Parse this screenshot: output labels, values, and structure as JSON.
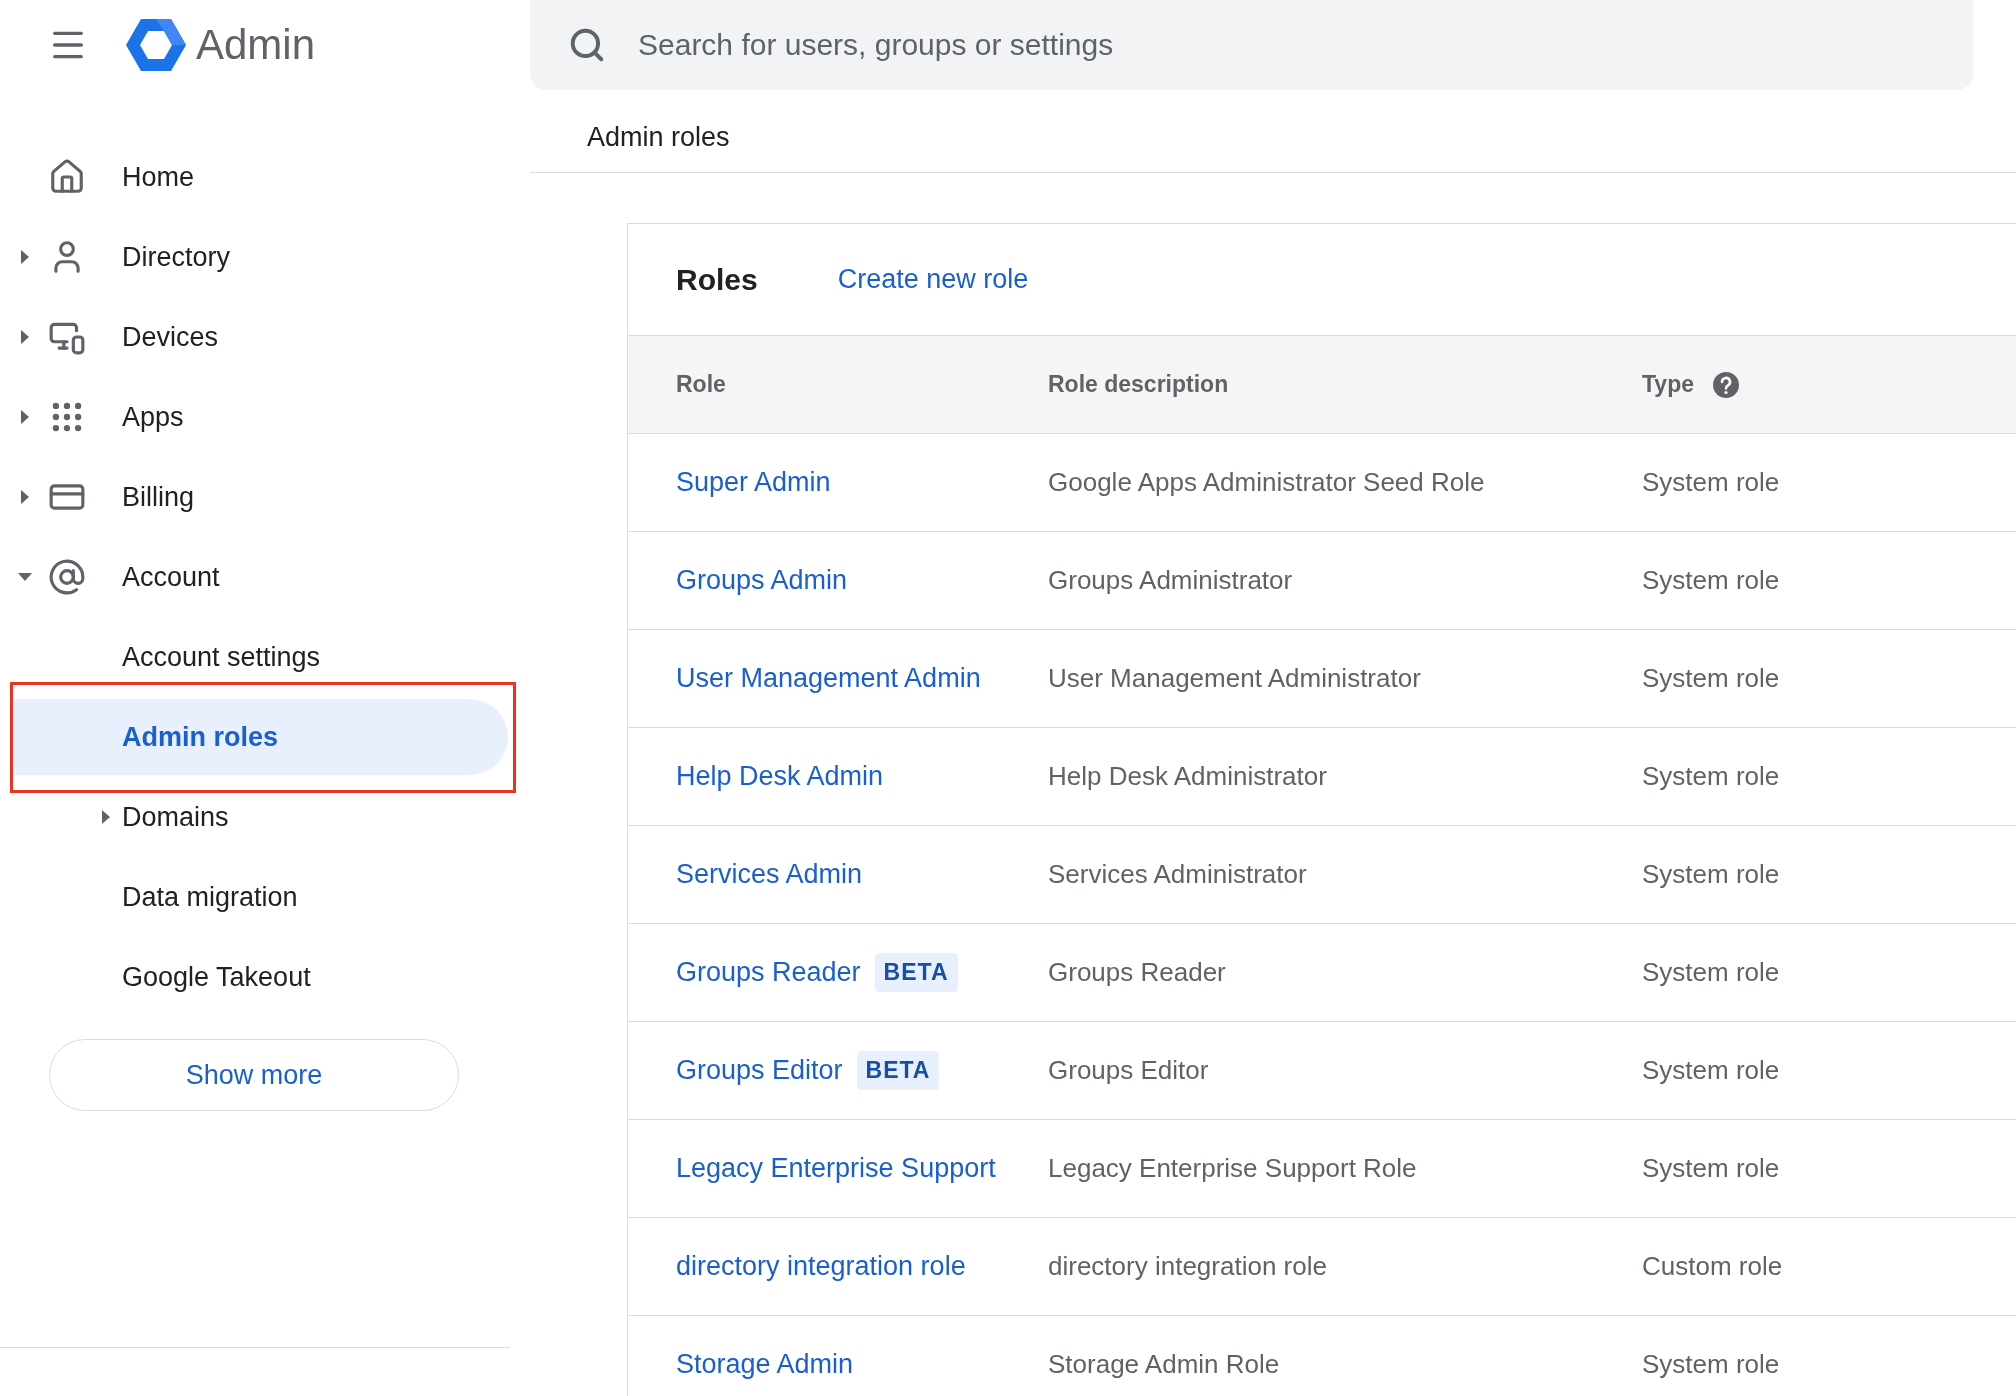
{
  "header": {
    "product": "Admin",
    "search": {
      "placeholder": "Search for users, groups or settings"
    }
  },
  "sidebar": {
    "items": [
      {
        "label": "Home",
        "expandable": false
      },
      {
        "label": "Directory",
        "expandable": true,
        "expanded": false
      },
      {
        "label": "Devices",
        "expandable": true,
        "expanded": false
      },
      {
        "label": "Apps",
        "expandable": true,
        "expanded": false
      },
      {
        "label": "Billing",
        "expandable": true,
        "expanded": false
      },
      {
        "label": "Account",
        "expandable": true,
        "expanded": true,
        "children": [
          {
            "label": "Account settings",
            "selected": false,
            "expandable": false,
            "highlighted": false
          },
          {
            "label": "Admin roles",
            "selected": true,
            "expandable": false,
            "highlighted": true
          },
          {
            "label": "Domains",
            "selected": false,
            "expandable": true,
            "highlighted": false
          },
          {
            "label": "Data migration",
            "selected": false,
            "expandable": false,
            "highlighted": false
          },
          {
            "label": "Google Takeout",
            "selected": false,
            "expandable": false,
            "highlighted": false
          }
        ]
      }
    ],
    "show_more": "Show more"
  },
  "breadcrumb": "Admin roles",
  "roles": {
    "title": "Roles",
    "create_link": "Create new role",
    "columns": [
      "Role",
      "Role description",
      "Type"
    ],
    "rows": [
      {
        "role": "Super Admin",
        "description": "Google Apps Administrator Seed Role",
        "type": "System role"
      },
      {
        "role": "Groups Admin",
        "description": "Groups Administrator",
        "type": "System role"
      },
      {
        "role": "User Management Admin",
        "description": "User Management Administrator",
        "type": "System role"
      },
      {
        "role": "Help Desk Admin",
        "description": "Help Desk Administrator",
        "type": "System role"
      },
      {
        "role": "Services Admin",
        "description": "Services Administrator",
        "type": "System role"
      },
      {
        "role": "Groups Reader",
        "badge": "BETA",
        "description": "Groups Reader",
        "type": "System role"
      },
      {
        "role": "Groups Editor",
        "badge": "BETA",
        "description": "Groups Editor",
        "type": "System role"
      },
      {
        "role": "Legacy Enterprise Support",
        "description": "Legacy Enterprise Support Role",
        "type": "System role"
      },
      {
        "role": "directory integration role",
        "description": "directory integration role",
        "type": "Custom role"
      },
      {
        "role": "Storage Admin",
        "description": "Storage Admin Role",
        "type": "System role"
      }
    ]
  }
}
